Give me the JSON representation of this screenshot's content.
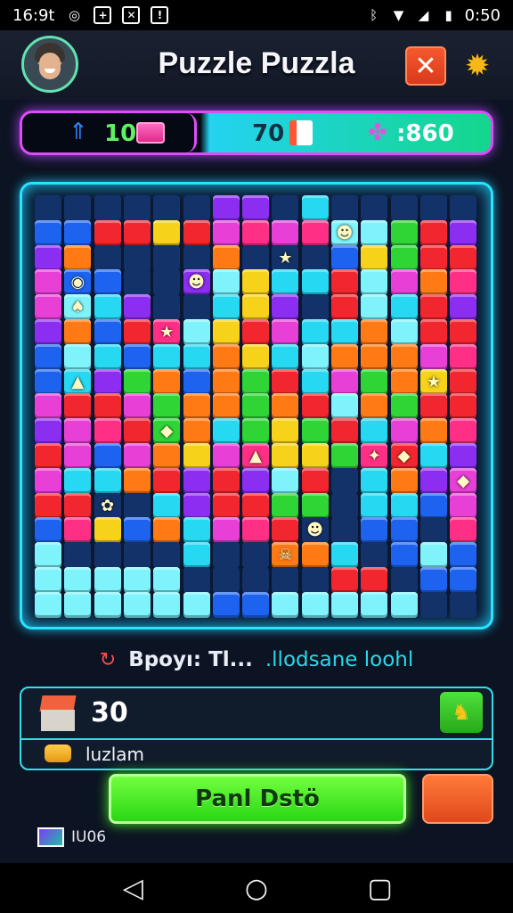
{
  "status_bar": {
    "time": "16:9t",
    "battery": "0:50"
  },
  "header": {
    "title": "Puzzle Puzzla",
    "close_icon": "close-icon",
    "settings_icon": "gear-icon"
  },
  "stats": {
    "level": "10",
    "moves": "70",
    "score": ":860"
  },
  "colors": {
    "accent_magenta": "#dd4ef6",
    "accent_cyan": "#27e4ff",
    "play_green": "#45f022",
    "close_orange": "#e0481a"
  },
  "board": {
    "palette": {
      "B": "#1d63f0",
      "C": "#27d8f2",
      "L": "#7ff3fb",
      "R": "#f2262f",
      "O": "#ff7a15",
      "Y": "#f7d21b",
      "G": "#2fd435",
      "M": "#e83fd6",
      "P": "#8c2df2",
      "K": "#ff2f86",
      "N": "#14326a",
      "E": "#0b1f3c"
    },
    "rows": [
      "NNNNNNPPNCNNNNN",
      "BBRRYRMKMKLLGRP",
      "PONNNNONNNBYGRR",
      "MBBNNPLYCCRLMOK",
      "MLCPNNCYPNRLCRP",
      "POBRKLYRMCCOLRR",
      "BLCBCCOYCLOOOMK",
      "BCPGOBOGRCMGOYR",
      "MRRMGOOGORLOGRR",
      "PMKRGOCGYGRCMOK",
      "RMBMOYMKYYGKRCP",
      "MCCORPRPLRNCOPM",
      "RRNNCPRRGGNCCBM",
      "BKYBOCMKRNNBBNK",
      "LNNNNCNNOOCNBLB",
      "LLLLLNNNNNRRNBB",
      "LLLLLLBBLLLLLNN"
    ],
    "specials": [
      {
        "r": 1,
        "c": 10,
        "icon": "ghost-icon",
        "glyph": "☻"
      },
      {
        "r": 2,
        "c": 8,
        "icon": "star-icon",
        "glyph": "★"
      },
      {
        "r": 3,
        "c": 5,
        "icon": "ghost-icon",
        "glyph": "☻"
      },
      {
        "r": 3,
        "c": 1,
        "icon": "eye-icon",
        "glyph": "◉"
      },
      {
        "r": 4,
        "c": 1,
        "icon": "bell-icon",
        "glyph": "♠"
      },
      {
        "r": 5,
        "c": 4,
        "icon": "star-icon",
        "glyph": "★"
      },
      {
        "r": 7,
        "c": 1,
        "icon": "rocket-icon",
        "glyph": "▲"
      },
      {
        "r": 7,
        "c": 13,
        "icon": "star-icon",
        "glyph": "★"
      },
      {
        "r": 9,
        "c": 4,
        "icon": "gem-icon",
        "glyph": "◆"
      },
      {
        "r": 10,
        "c": 7,
        "icon": "rocket-icon",
        "glyph": "▲"
      },
      {
        "r": 10,
        "c": 11,
        "icon": "ghost-icon",
        "glyph": "✦"
      },
      {
        "r": 10,
        "c": 12,
        "icon": "gem-icon",
        "glyph": "◆"
      },
      {
        "r": 11,
        "c": 14,
        "icon": "gem-icon",
        "glyph": "◆"
      },
      {
        "r": 12,
        "c": 2,
        "icon": "flower-icon",
        "glyph": "✿"
      },
      {
        "r": 13,
        "c": 9,
        "icon": "ghost-icon",
        "glyph": "☻"
      },
      {
        "r": 14,
        "c": 8,
        "icon": "skull-icon",
        "glyph": "☠"
      }
    ]
  },
  "bonus": {
    "label": "Bpoyı: Tl...",
    "value": ".llodsane loohl"
  },
  "goal": {
    "count": "30",
    "subtitle": "luzlam"
  },
  "actions": {
    "play_label": "Panl Dstö"
  },
  "footer": {
    "tag": "IU06"
  }
}
